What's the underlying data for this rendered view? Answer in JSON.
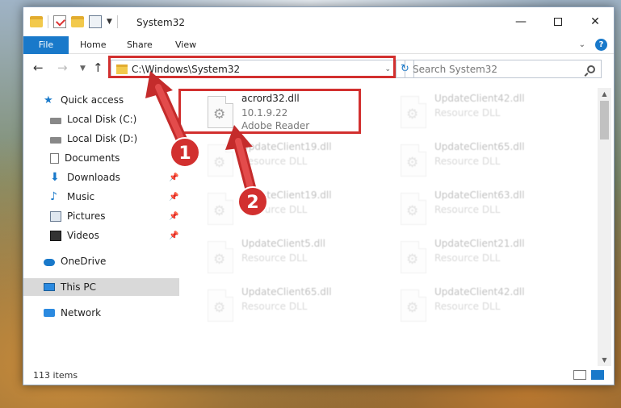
{
  "window": {
    "title": "System32",
    "controls": {
      "minimize": "—",
      "close": "✕"
    }
  },
  "ribbon": {
    "tabs": [
      "File",
      "Home",
      "Share",
      "View"
    ]
  },
  "address": {
    "path": "C:\\Windows\\System32",
    "search_placeholder": "Search System32"
  },
  "sidebar": {
    "items": [
      {
        "label": "Quick access",
        "icon": "star-icon",
        "pinned": false
      },
      {
        "label": "Local Disk (C:)",
        "icon": "drive-icon",
        "pinned": true
      },
      {
        "label": "Local Disk (D:)",
        "icon": "drive-icon",
        "pinned": true
      },
      {
        "label": "Documents",
        "icon": "documents-icon",
        "pinned": true
      },
      {
        "label": "Downloads",
        "icon": "downloads-icon",
        "pinned": true
      },
      {
        "label": "Music",
        "icon": "music-icon",
        "pinned": true
      },
      {
        "label": "Pictures",
        "icon": "pictures-icon",
        "pinned": true
      },
      {
        "label": "Videos",
        "icon": "videos-icon",
        "pinned": true
      },
      {
        "label": "OneDrive",
        "icon": "onedrive-icon",
        "pinned": false
      },
      {
        "label": "This PC",
        "icon": "pc-icon",
        "pinned": false,
        "selected": true
      },
      {
        "label": "Network",
        "icon": "network-icon",
        "pinned": false
      }
    ]
  },
  "files": [
    {
      "name": "acrord32.dll",
      "line2": "10.1.9.22",
      "line3": "Adobe Reader",
      "highlighted": true
    },
    {
      "name": "UpdateClient42.dll",
      "line2": "Resource DLL"
    },
    {
      "name": "UpdateClient19.dll",
      "line2": "Resource DLL"
    },
    {
      "name": "UpdateClient65.dll",
      "line2": "Resource DLL"
    },
    {
      "name": "UpdateClient19.dll",
      "line2": "Resource DLL"
    },
    {
      "name": "UpdateClient63.dll",
      "line2": "Resource DLL"
    },
    {
      "name": "UpdateClient5.dll",
      "line2": "Resource DLL"
    },
    {
      "name": "UpdateClient21.dll",
      "line2": "Resource DLL"
    },
    {
      "name": "UpdateClient65.dll",
      "line2": "Resource DLL"
    },
    {
      "name": "UpdateClient42.dll",
      "line2": "Resource DLL"
    }
  ],
  "status": {
    "item_count": "113 items"
  },
  "annotations": {
    "markers": [
      "1",
      "2"
    ],
    "color": "#d2302f"
  },
  "colors": {
    "accent": "#1979ca",
    "highlight": "#d2302f"
  }
}
